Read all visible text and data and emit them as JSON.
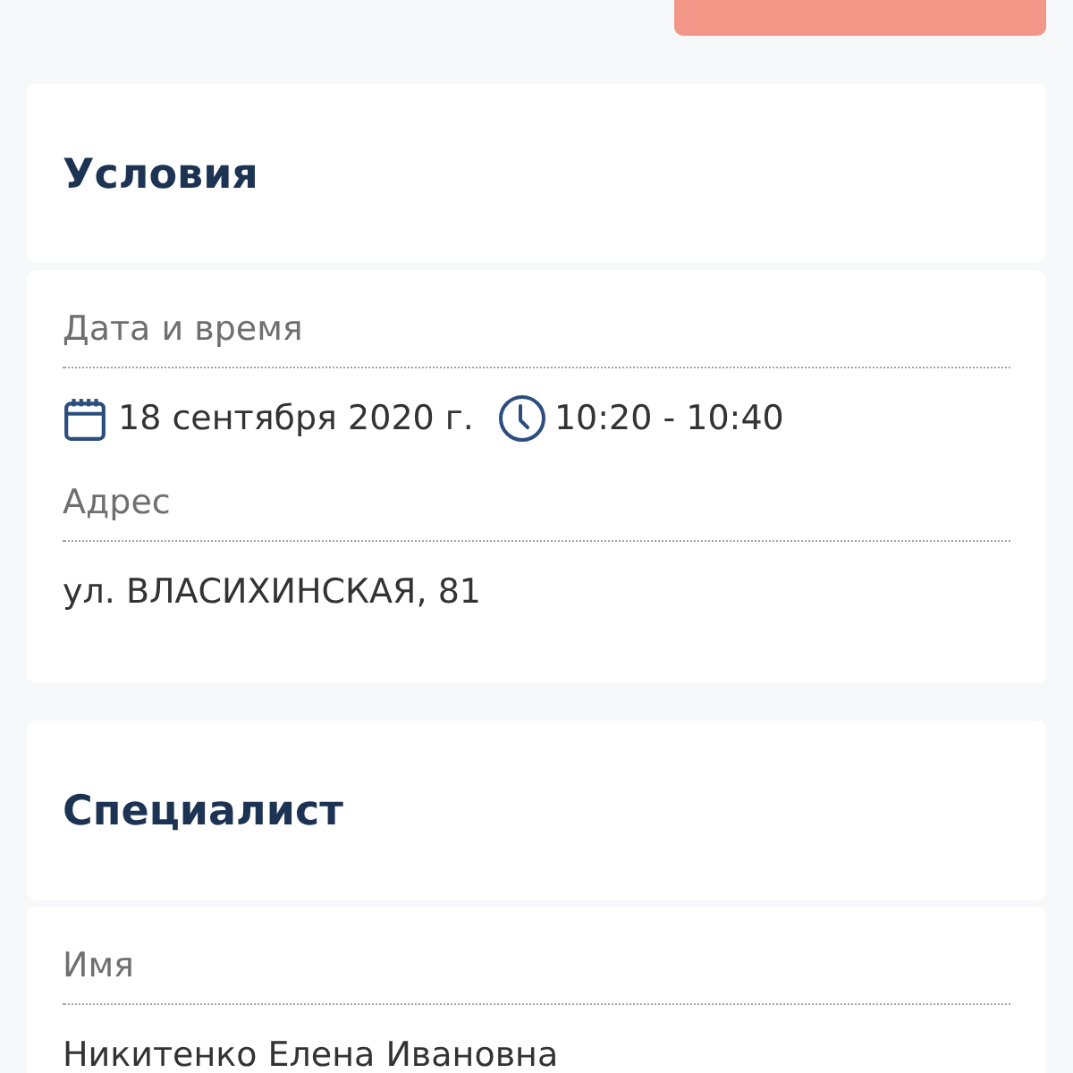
{
  "sections": [
    {
      "title": "Условия",
      "fields": [
        {
          "kind": "datetime",
          "label": "Дата и время",
          "date": "18 сентября 2020 г.",
          "time": "10:20 - 10:40"
        },
        {
          "kind": "text",
          "label": "Адрес",
          "value": "ул. ВЛАСИХИНСКАЯ, 81"
        }
      ]
    },
    {
      "title": "Специалист",
      "fields": [
        {
          "kind": "text",
          "label": "Имя",
          "value": "Никитенко Елена Ивановна"
        }
      ]
    }
  ]
}
